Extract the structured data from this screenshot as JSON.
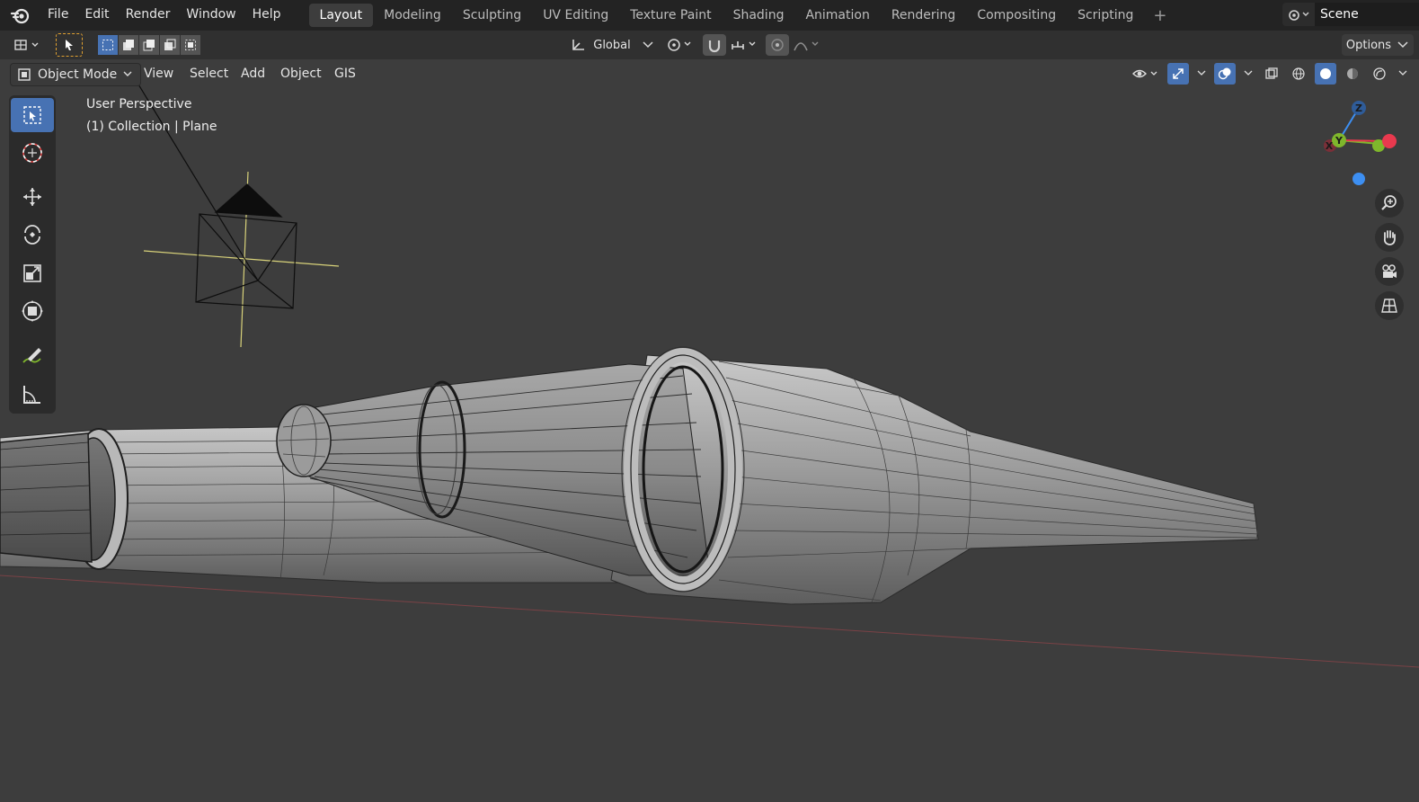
{
  "menu": [
    "File",
    "Edit",
    "Render",
    "Window",
    "Help"
  ],
  "workspaces": [
    "Layout",
    "Modeling",
    "Sculpting",
    "UV Editing",
    "Texture Paint",
    "Shading",
    "Animation",
    "Rendering",
    "Compositing",
    "Scripting"
  ],
  "active_workspace": "Layout",
  "add_workspace_label": "+",
  "scene_name": "Scene",
  "tool_header": {
    "orientation_label": "Global",
    "options_label": "Options"
  },
  "view_header": {
    "mode_label": "Object Mode",
    "menus": [
      "View",
      "Select",
      "Add",
      "Object",
      "GIS"
    ]
  },
  "viewport": {
    "view_name": "User Perspective",
    "collection_info": "(1) Collection | Plane"
  },
  "gizmo_axes": {
    "x": "X",
    "y": "Y",
    "z": "Z"
  },
  "icons": {
    "logo": "blender-logo-icon",
    "editor_type": "editor-type-icon",
    "tool_select": "select-box-icon",
    "tool_cursor": "cursor-icon",
    "tool_move": "move-icon",
    "tool_rotate": "rotate-icon",
    "tool_scale": "scale-icon",
    "tool_transform": "transform-icon",
    "tool_annotate": "annotate-icon",
    "tool_measure": "measure-icon",
    "nav_zoom": "zoom-icon",
    "nav_pan": "hand-icon",
    "nav_camera": "camera-icon",
    "nav_ortho": "grid-icon"
  },
  "colors": {
    "accent": "#4772b3",
    "x_axis": "#e9394e",
    "y_axis": "#7fb62c",
    "z_axis": "#3d8ff2",
    "viewport_bg": "#3d3d3d"
  }
}
